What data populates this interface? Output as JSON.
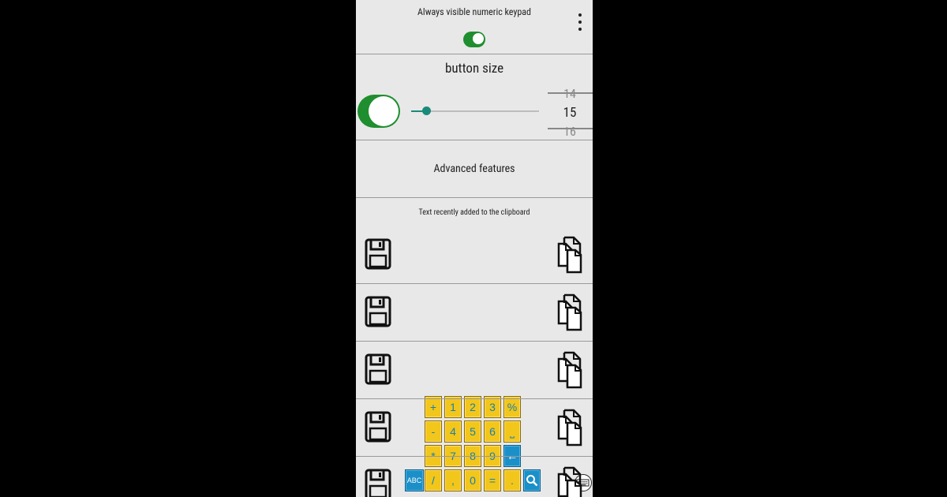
{
  "header": {
    "keypad_label": "Always visible numeric keypad",
    "keypad_toggle_on": true,
    "menu_icon": "more-vert-icon"
  },
  "button_size": {
    "label": "button size",
    "toggle_on": true,
    "slider_value_fraction": 0.12,
    "picker": {
      "prev": "14",
      "current": "15",
      "next": "16"
    }
  },
  "advanced": {
    "label": "Advanced features"
  },
  "clipboard": {
    "label": "Text recently added to the clipboard",
    "rows": [
      {
        "save_icon": "floppy-disk-icon",
        "copy_icon": "copy-documents-icon"
      },
      {
        "save_icon": "floppy-disk-icon",
        "copy_icon": "copy-documents-icon"
      },
      {
        "save_icon": "floppy-disk-icon",
        "copy_icon": "copy-documents-icon"
      },
      {
        "save_icon": "floppy-disk-icon",
        "copy_icon": "copy-documents-icon"
      },
      {
        "save_icon": "floppy-disk-icon",
        "copy_icon": "copy-documents-icon"
      }
    ]
  },
  "keypad": {
    "rows": [
      [
        "+",
        "1",
        "2",
        "3",
        "%"
      ],
      [
        "-",
        "4",
        "5",
        "6",
        "⎵"
      ],
      [
        "*",
        "7",
        "8",
        "9",
        "←"
      ],
      [
        "/",
        ",",
        "0",
        "=",
        "."
      ]
    ],
    "abc_label": "ABC",
    "search_icon": "search-icon",
    "keyboard_icon": "keyboard-icon"
  },
  "colors": {
    "toggle_green": "#1e8e2e",
    "slider_teal": "#1a8a7a",
    "key_yellow": "#f2c61a",
    "key_blue": "#1a8fc8",
    "key_text": "#1a7fb0"
  }
}
